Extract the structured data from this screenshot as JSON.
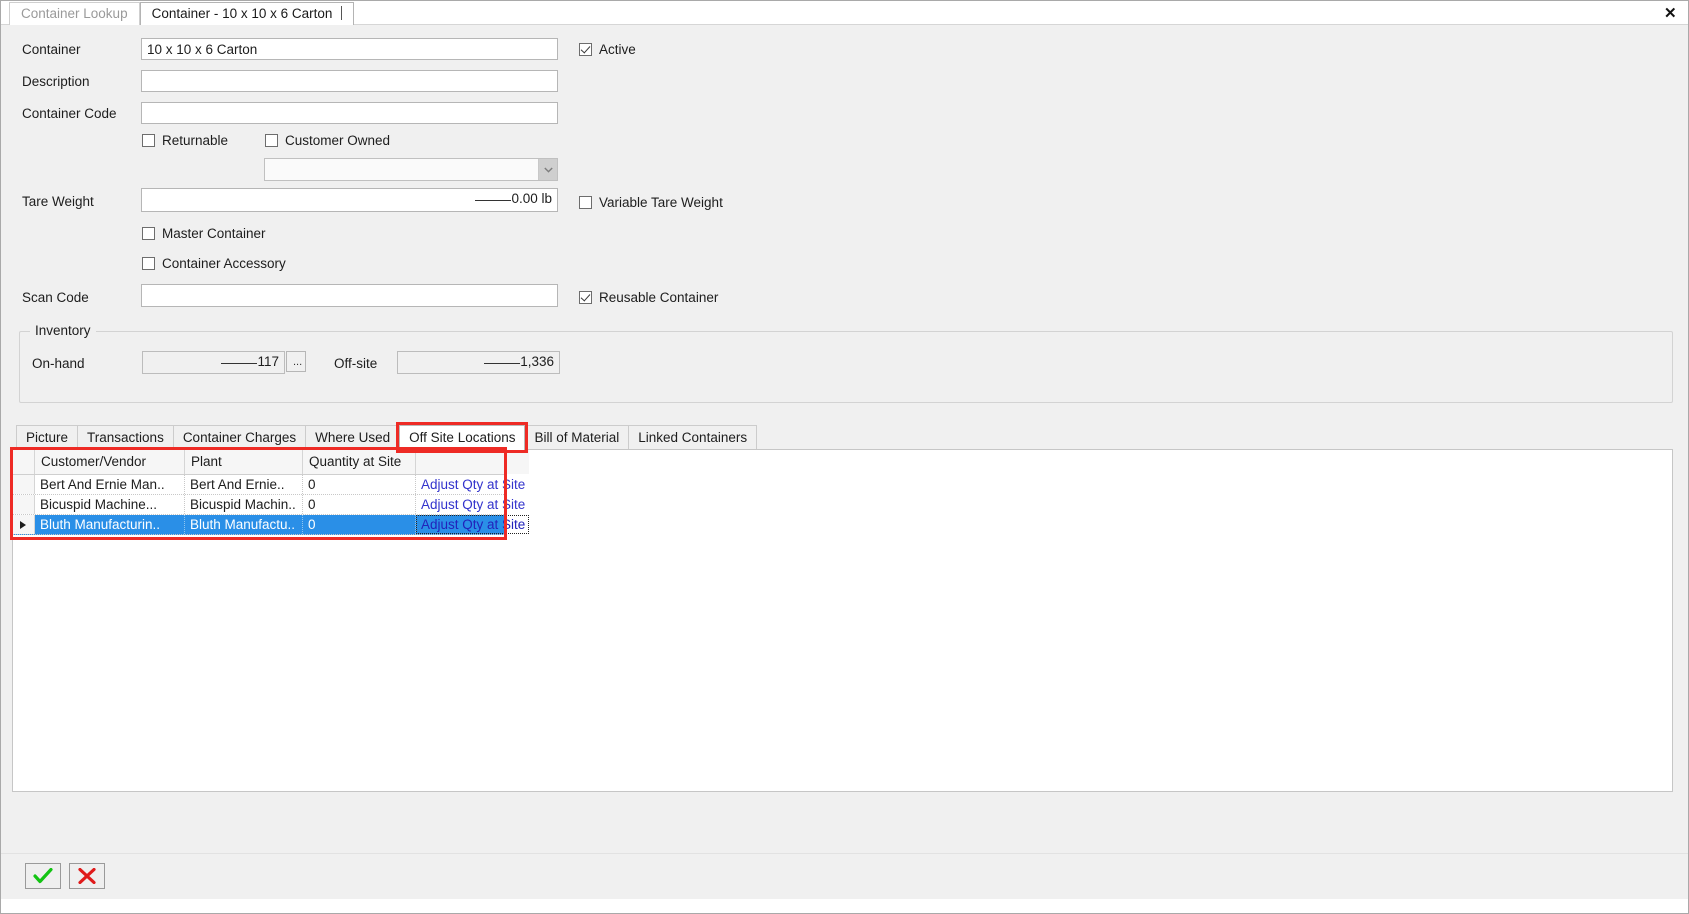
{
  "window": {
    "close_label": "✕"
  },
  "top_tabs": [
    {
      "label": "Container Lookup",
      "active": false
    },
    {
      "label": "Container - 10 x 10 x 6 Carton",
      "active": true
    }
  ],
  "form": {
    "fields": [
      {
        "label": "Container",
        "value": "10 x 10 x 6 Carton",
        "placeholder": ""
      },
      {
        "label": "Description",
        "value": "",
        "placeholder": ""
      },
      {
        "label": "Container Code",
        "value": "",
        "placeholder": ""
      },
      {
        "label": "Tare Weight",
        "value": "0.00 lb",
        "placeholder": ""
      },
      {
        "label": "Scan Code",
        "value": "",
        "placeholder": ""
      }
    ],
    "checkboxes": [
      {
        "label": "Active",
        "checked": true
      },
      {
        "label": "Returnable",
        "checked": false
      },
      {
        "label": "Customer Owned",
        "checked": false
      },
      {
        "label": "Variable Tare Weight",
        "checked": false
      },
      {
        "label": "Master Container",
        "checked": false
      },
      {
        "label": "Container Accessory",
        "checked": false
      },
      {
        "label": "Reusable Container",
        "checked": true
      }
    ],
    "owner_combo": {
      "value": "",
      "placeholder": ""
    }
  },
  "inventory": {
    "title": "Inventory",
    "on_hand_label": "On-hand",
    "on_hand_value": "117",
    "on_hand_browse": "...",
    "off_site_label": "Off-site",
    "off_site_value": "1,336"
  },
  "bottom_tabs": [
    {
      "label": "Picture",
      "active": false,
      "highlighted": false
    },
    {
      "label": "Transactions",
      "active": false,
      "highlighted": false
    },
    {
      "label": "Container Charges",
      "active": false,
      "highlighted": false
    },
    {
      "label": "Where Used",
      "active": false,
      "highlighted": false
    },
    {
      "label": "Off Site Locations",
      "active": true,
      "highlighted": true
    },
    {
      "label": "Bill of Material",
      "active": false,
      "highlighted": false
    },
    {
      "label": "Linked Containers",
      "active": false,
      "highlighted": false
    }
  ],
  "grid": {
    "columns": [
      "Customer/Vendor",
      "Plant",
      "Quantity at Site",
      ""
    ],
    "rows": [
      {
        "customer": "Bert And Ernie Man..",
        "plant": "Bert And Ernie..",
        "qty": "0",
        "action": "Adjust Qty at Site",
        "selected": false,
        "focused": false
      },
      {
        "customer": "Bicuspid Machine...",
        "plant": "Bicuspid Machin..",
        "qty": "0",
        "action": "Adjust Qty at Site",
        "selected": false,
        "focused": false
      },
      {
        "customer": "Bluth  Manufacturin..",
        "plant": "Bluth  Manufactu..",
        "qty": "0",
        "action": "Adjust Qty at Site",
        "selected": true,
        "focused": true
      }
    ]
  },
  "footer": {
    "ok_label": "OK",
    "cancel_label": "Cancel"
  },
  "colors": {
    "highlight_red": "#ee2b25",
    "row_select_blue": "#2a8fe7",
    "link_blue": "#3333cc"
  }
}
